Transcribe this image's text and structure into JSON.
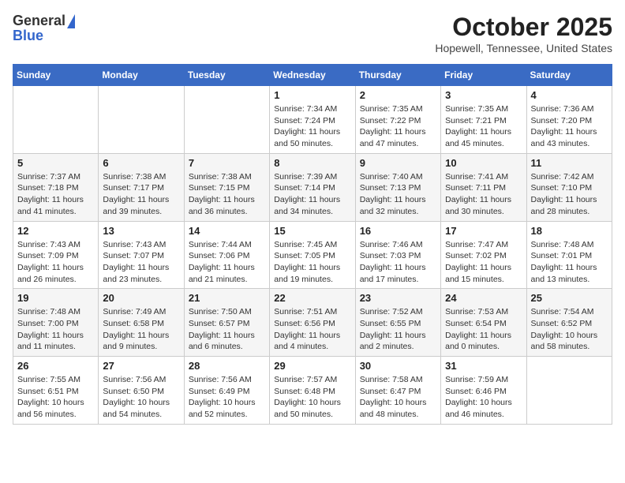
{
  "header": {
    "logo": {
      "line1": "General",
      "line2": "Blue"
    },
    "title": "October 2025",
    "location": "Hopewell, Tennessee, United States"
  },
  "weekdays": [
    "Sunday",
    "Monday",
    "Tuesday",
    "Wednesday",
    "Thursday",
    "Friday",
    "Saturday"
  ],
  "weeks": [
    [
      {
        "day": "",
        "info": ""
      },
      {
        "day": "",
        "info": ""
      },
      {
        "day": "",
        "info": ""
      },
      {
        "day": "1",
        "info": "Sunrise: 7:34 AM\nSunset: 7:24 PM\nDaylight: 11 hours\nand 50 minutes."
      },
      {
        "day": "2",
        "info": "Sunrise: 7:35 AM\nSunset: 7:22 PM\nDaylight: 11 hours\nand 47 minutes."
      },
      {
        "day": "3",
        "info": "Sunrise: 7:35 AM\nSunset: 7:21 PM\nDaylight: 11 hours\nand 45 minutes."
      },
      {
        "day": "4",
        "info": "Sunrise: 7:36 AM\nSunset: 7:20 PM\nDaylight: 11 hours\nand 43 minutes."
      }
    ],
    [
      {
        "day": "5",
        "info": "Sunrise: 7:37 AM\nSunset: 7:18 PM\nDaylight: 11 hours\nand 41 minutes."
      },
      {
        "day": "6",
        "info": "Sunrise: 7:38 AM\nSunset: 7:17 PM\nDaylight: 11 hours\nand 39 minutes."
      },
      {
        "day": "7",
        "info": "Sunrise: 7:38 AM\nSunset: 7:15 PM\nDaylight: 11 hours\nand 36 minutes."
      },
      {
        "day": "8",
        "info": "Sunrise: 7:39 AM\nSunset: 7:14 PM\nDaylight: 11 hours\nand 34 minutes."
      },
      {
        "day": "9",
        "info": "Sunrise: 7:40 AM\nSunset: 7:13 PM\nDaylight: 11 hours\nand 32 minutes."
      },
      {
        "day": "10",
        "info": "Sunrise: 7:41 AM\nSunset: 7:11 PM\nDaylight: 11 hours\nand 30 minutes."
      },
      {
        "day": "11",
        "info": "Sunrise: 7:42 AM\nSunset: 7:10 PM\nDaylight: 11 hours\nand 28 minutes."
      }
    ],
    [
      {
        "day": "12",
        "info": "Sunrise: 7:43 AM\nSunset: 7:09 PM\nDaylight: 11 hours\nand 26 minutes."
      },
      {
        "day": "13",
        "info": "Sunrise: 7:43 AM\nSunset: 7:07 PM\nDaylight: 11 hours\nand 23 minutes."
      },
      {
        "day": "14",
        "info": "Sunrise: 7:44 AM\nSunset: 7:06 PM\nDaylight: 11 hours\nand 21 minutes."
      },
      {
        "day": "15",
        "info": "Sunrise: 7:45 AM\nSunset: 7:05 PM\nDaylight: 11 hours\nand 19 minutes."
      },
      {
        "day": "16",
        "info": "Sunrise: 7:46 AM\nSunset: 7:03 PM\nDaylight: 11 hours\nand 17 minutes."
      },
      {
        "day": "17",
        "info": "Sunrise: 7:47 AM\nSunset: 7:02 PM\nDaylight: 11 hours\nand 15 minutes."
      },
      {
        "day": "18",
        "info": "Sunrise: 7:48 AM\nSunset: 7:01 PM\nDaylight: 11 hours\nand 13 minutes."
      }
    ],
    [
      {
        "day": "19",
        "info": "Sunrise: 7:48 AM\nSunset: 7:00 PM\nDaylight: 11 hours\nand 11 minutes."
      },
      {
        "day": "20",
        "info": "Sunrise: 7:49 AM\nSunset: 6:58 PM\nDaylight: 11 hours\nand 9 minutes."
      },
      {
        "day": "21",
        "info": "Sunrise: 7:50 AM\nSunset: 6:57 PM\nDaylight: 11 hours\nand 6 minutes."
      },
      {
        "day": "22",
        "info": "Sunrise: 7:51 AM\nSunset: 6:56 PM\nDaylight: 11 hours\nand 4 minutes."
      },
      {
        "day": "23",
        "info": "Sunrise: 7:52 AM\nSunset: 6:55 PM\nDaylight: 11 hours\nand 2 minutes."
      },
      {
        "day": "24",
        "info": "Sunrise: 7:53 AM\nSunset: 6:54 PM\nDaylight: 11 hours\nand 0 minutes."
      },
      {
        "day": "25",
        "info": "Sunrise: 7:54 AM\nSunset: 6:52 PM\nDaylight: 10 hours\nand 58 minutes."
      }
    ],
    [
      {
        "day": "26",
        "info": "Sunrise: 7:55 AM\nSunset: 6:51 PM\nDaylight: 10 hours\nand 56 minutes."
      },
      {
        "day": "27",
        "info": "Sunrise: 7:56 AM\nSunset: 6:50 PM\nDaylight: 10 hours\nand 54 minutes."
      },
      {
        "day": "28",
        "info": "Sunrise: 7:56 AM\nSunset: 6:49 PM\nDaylight: 10 hours\nand 52 minutes."
      },
      {
        "day": "29",
        "info": "Sunrise: 7:57 AM\nSunset: 6:48 PM\nDaylight: 10 hours\nand 50 minutes."
      },
      {
        "day": "30",
        "info": "Sunrise: 7:58 AM\nSunset: 6:47 PM\nDaylight: 10 hours\nand 48 minutes."
      },
      {
        "day": "31",
        "info": "Sunrise: 7:59 AM\nSunset: 6:46 PM\nDaylight: 10 hours\nand 46 minutes."
      },
      {
        "day": "",
        "info": ""
      }
    ]
  ]
}
